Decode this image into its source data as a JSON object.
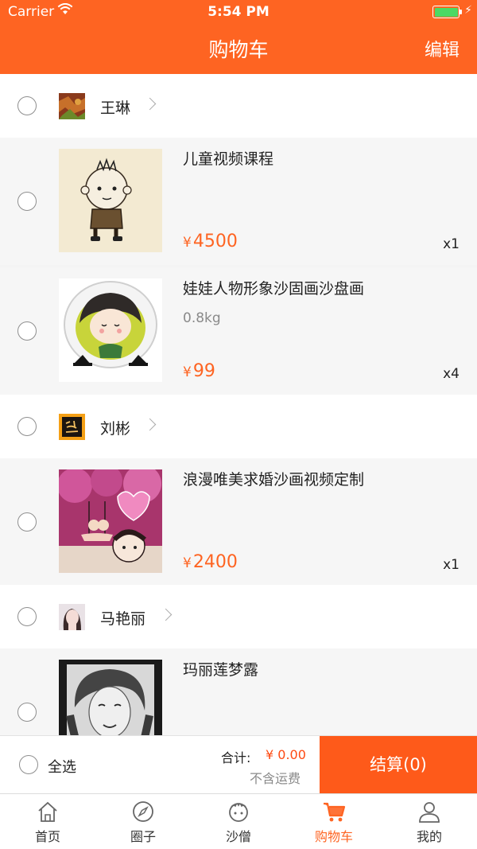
{
  "status_bar": {
    "carrier": "Carrier",
    "time": "5:54 PM"
  },
  "nav": {
    "title": "购物车",
    "edit": "编辑"
  },
  "shops": [
    {
      "name": "王琳",
      "items": [
        {
          "title": "儿童视频课程",
          "weight": "",
          "price": "4500",
          "qty": "x1"
        }
      ]
    },
    {
      "name": "娃娃人物形象沙固画沙盘画",
      "items": []
    }
  ],
  "cart": {
    "shop1": {
      "name": "王琳"
    },
    "item1": {
      "title": "儿童视频课程",
      "price": "4500",
      "qty": "x1"
    },
    "item2": {
      "title": "娃娃人物形象沙固画沙盘画",
      "weight": "0.8kg",
      "price": "99",
      "qty": "x4"
    },
    "shop2": {
      "name": "刘彬"
    },
    "item3": {
      "title": "浪漫唯美求婚沙画视频定制",
      "price": "2400",
      "qty": "x1"
    },
    "shop3": {
      "name": "马艳丽"
    },
    "item4": {
      "title": "玛丽莲梦露"
    }
  },
  "currency": "¥",
  "checkout": {
    "select_all": "全选",
    "total_label": "合计:",
    "total_value": "¥ 0.00",
    "shipping_note": "不含运费",
    "pay_button": "结算(0)"
  },
  "tabs": [
    {
      "label": "首页",
      "icon": "home-icon"
    },
    {
      "label": "圈子",
      "icon": "compass-icon"
    },
    {
      "label": "沙僧",
      "icon": "monk-icon"
    },
    {
      "label": "购物车",
      "icon": "cart-icon"
    },
    {
      "label": "我的",
      "icon": "person-icon"
    }
  ],
  "colors": {
    "accent": "#fe6422",
    "price": "#fe6422"
  }
}
